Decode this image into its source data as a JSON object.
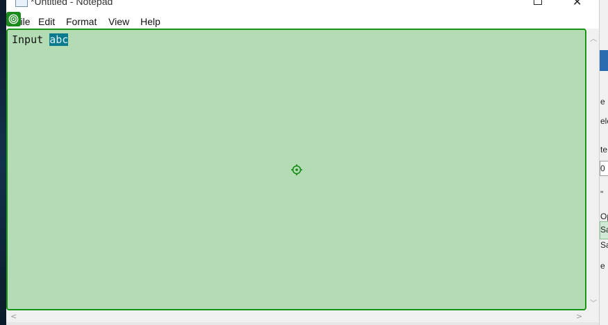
{
  "window": {
    "title": "*Untitled - Notepad",
    "icon": "notepad-icon"
  },
  "menu": {
    "file": "File",
    "edit": "Edit",
    "format": "Format",
    "view": "View",
    "help": "Help"
  },
  "editor": {
    "text_before_selection": "Input ",
    "selected_text": "abc",
    "focus_color": "#159415",
    "highlight_color": "#b4dcb4",
    "selection_color": "#0b7a8e"
  },
  "background_window": {
    "fragments": [
      "e",
      "ele",
      "te",
      "0",
      "\"",
      "Op",
      "Sa",
      "Sa",
      "e I"
    ]
  }
}
